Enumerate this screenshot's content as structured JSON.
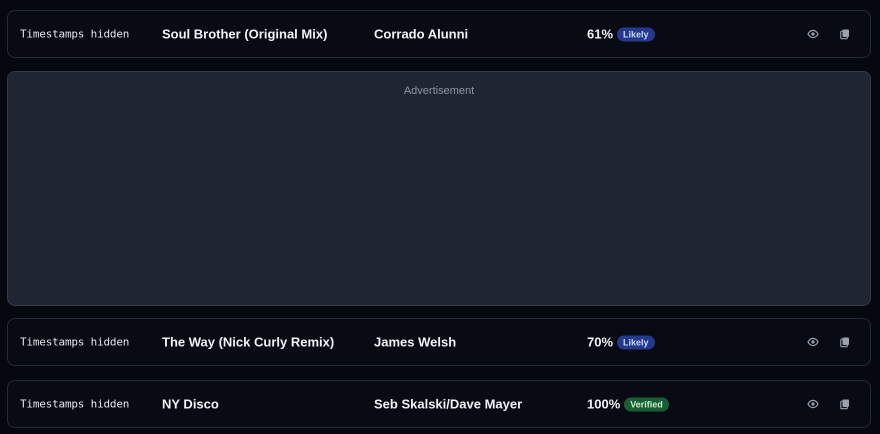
{
  "rows_top": {
    "timestamp": "Timestamps hidden",
    "title": "Soul Brother (Original Mix)",
    "artist": "Corrado Alunni",
    "confidence": "61%",
    "badge": "Likely"
  },
  "advertisement": {
    "label": "Advertisement"
  },
  "rows_bottom": [
    {
      "timestamp": "Timestamps hidden",
      "title": "The Way (Nick Curly Remix)",
      "artist": "James Welsh",
      "confidence": "70%",
      "badge": "Likely"
    },
    {
      "timestamp": "Timestamps hidden",
      "title": "NY Disco",
      "artist": "Seb Skalski/Dave Mayer",
      "confidence": "100%",
      "badge": "Verified"
    }
  ],
  "icons": {
    "view": "eye-icon",
    "copy": "copy-icon"
  },
  "colors": {
    "background": "#06080f",
    "row_border": "#242a38",
    "ad_background": "#1f2631",
    "badge_likely": "#22398c",
    "badge_verified": "#1b5e34"
  }
}
